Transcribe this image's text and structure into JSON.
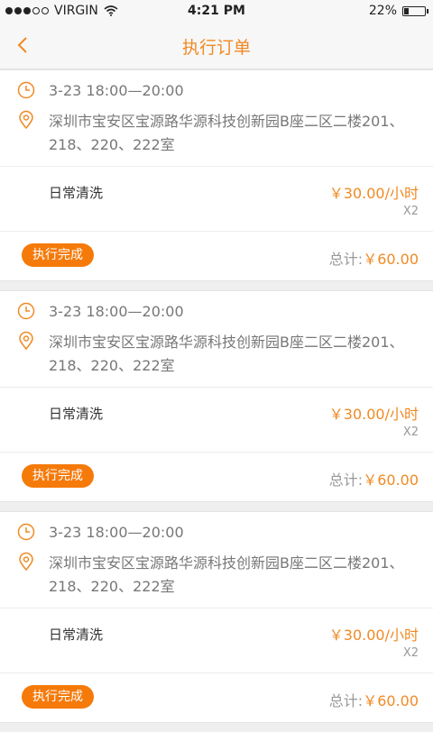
{
  "status_bar": {
    "carrier": "VIRGIN",
    "time": "4:21 PM",
    "battery": "22%",
    "battery_level": 0.22
  },
  "nav": {
    "title": "执行订单",
    "back_icon": "chevron-left-icon"
  },
  "colors": {
    "accent": "#f08a24",
    "button": "#f57a0a"
  },
  "orders": [
    {
      "time": "3-23 18:00—20:00",
      "address": "深圳市宝安区宝源路华源科技创新园B座二区二楼201、218、220、222室",
      "service": "日常清洗",
      "price": "￥30.00/小时",
      "quantity": "X2",
      "button": "执行完成",
      "total_label": "总计:",
      "total_amount": "￥60.00"
    },
    {
      "time": "3-23 18:00—20:00",
      "address": "深圳市宝安区宝源路华源科技创新园B座二区二楼201、218、220、222室",
      "service": "日常清洗",
      "price": "￥30.00/小时",
      "quantity": "X2",
      "button": "执行完成",
      "total_label": "总计:",
      "total_amount": "￥60.00"
    },
    {
      "time": "3-23 18:00—20:00",
      "address": "深圳市宝安区宝源路华源科技创新园B座二区二楼201、218、220、222室",
      "service": "日常清洗",
      "price": "￥30.00/小时",
      "quantity": "X2",
      "button": "执行完成",
      "total_label": "总计:",
      "total_amount": "￥60.00"
    }
  ]
}
